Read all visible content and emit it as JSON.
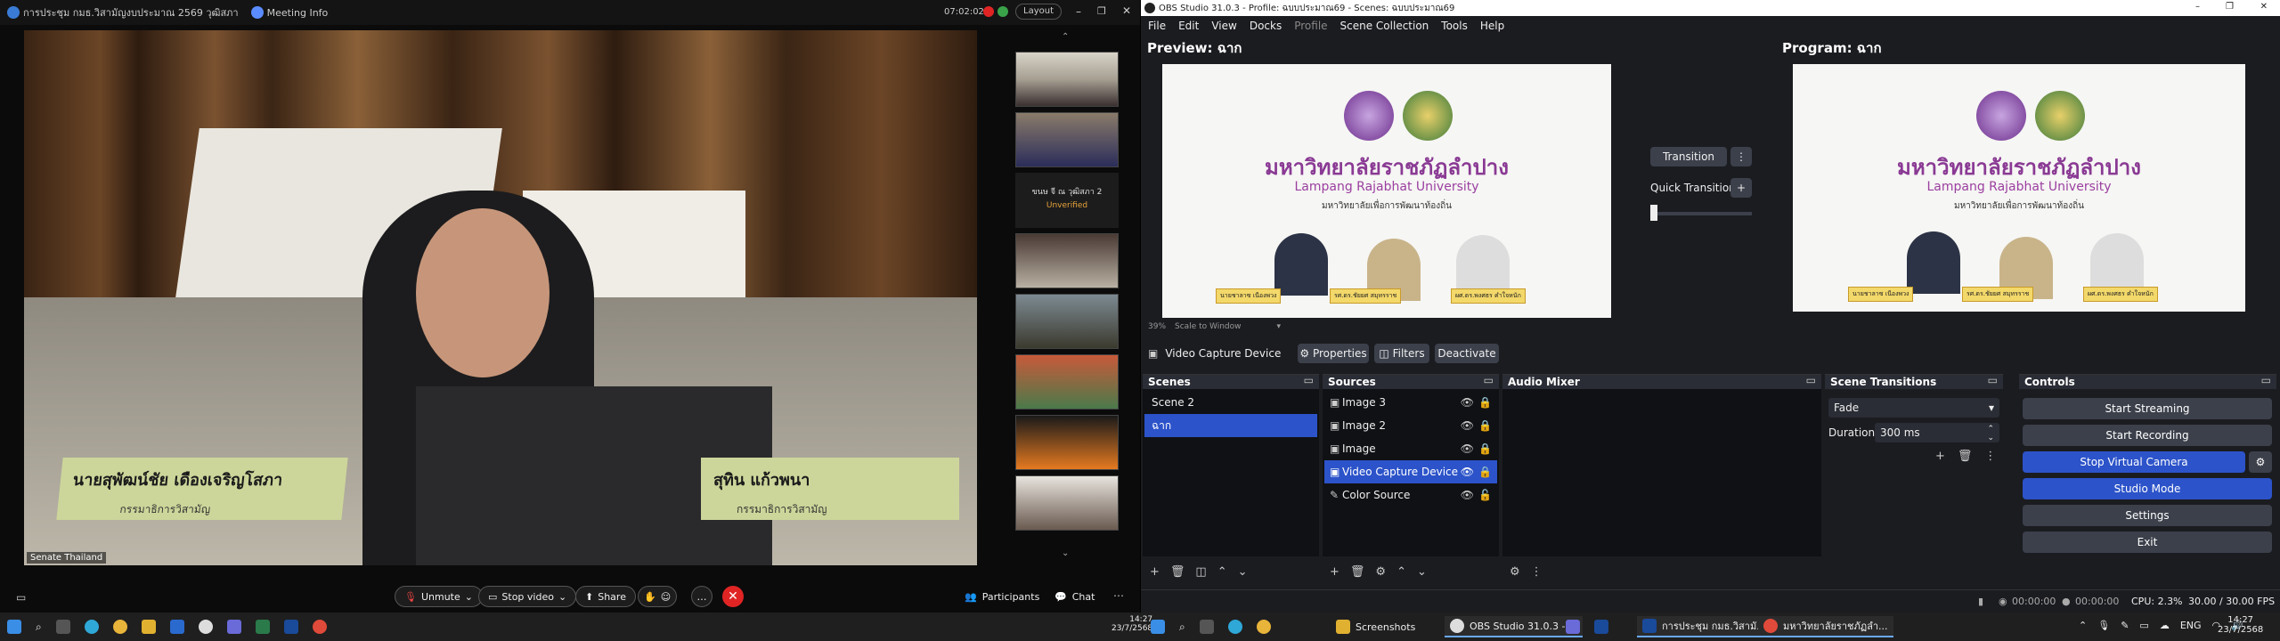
{
  "meeting": {
    "title": "การประชุม กมธ.วิสามัญงบประมาณ 2569 วุฒิสภา",
    "meeting_info": "Meeting Info",
    "timer": "07:02:02",
    "layout": "Layout",
    "video_label": "Senate Thailand",
    "nameplate_left": "นายสุพัฒน์ชัย เดืองเจริญโสภา",
    "nameplate_left_sub": "กรรมาธิการวิสามัญ",
    "nameplate_right": "สุทิน แก้วพนา",
    "nameplate_right_sub": "กรรมาธิการวิสามัญ",
    "thumb_text_participant": "ขนษ จี ณ วุฒิสภา 2",
    "thumb_text_status": "Unverified",
    "controls": {
      "unmute": "Unmute",
      "stop_video": "Stop video",
      "share": "Share",
      "participants": "Participants",
      "chat": "Chat"
    }
  },
  "obs": {
    "title": "OBS Studio 31.0.3 - Profile: ฉบบประมาณ69 - Scenes: ฉบบประมาณ69",
    "menu": [
      "File",
      "Edit",
      "View",
      "Docks",
      "Profile",
      "Scene Collection",
      "Tools",
      "Help"
    ],
    "preview_title": "Preview: ฉาก",
    "program_title": "Program: ฉาก",
    "screen": {
      "thai_name": "มหาวิทยาลัยราชภัฏลำปาง",
      "eng_name": "Lampang Rajabhat University",
      "sub_name": "มหาวิทยาลัยเพื่อการพัฒนาท้องถิ่น",
      "nameplates": [
        "นายชาลาซ เนืองพวง",
        "รศ.ดร.ชัยยศ สมุทรราช",
        "ผศ.ดร.พงศธร คำใจหนัก"
      ]
    },
    "zoom": "39%",
    "scale_mode": "Scale to Window",
    "transition_btn": "Transition",
    "quick_transitions": "Quick Transitions",
    "source_toolbar": {
      "name": "Video Capture Device",
      "properties": "Properties",
      "filters": "Filters",
      "deactivate": "Deactivate"
    },
    "scenes": {
      "title": "Scenes",
      "items": [
        "Scene 2",
        "ฉาก"
      ]
    },
    "sources": {
      "title": "Sources",
      "items": [
        "Image 3",
        "Image 2",
        "Image",
        "Video Capture Device",
        "Color Source"
      ]
    },
    "audio_mixer": "Audio Mixer",
    "scene_transitions": {
      "title": "Scene Transitions",
      "type": "Fade",
      "duration_label": "Duration",
      "duration_value": "300 ms"
    },
    "controls": {
      "title": "Controls",
      "start_streaming": "Start Streaming",
      "start_recording": "Start Recording",
      "stop_virtual_camera": "Stop Virtual Camera",
      "studio_mode": "Studio Mode",
      "settings": "Settings",
      "exit": "Exit"
    },
    "status": {
      "stream_time": "00:00:00",
      "rec_time": "00:00:00",
      "cpu": "CPU: 2.3%",
      "fps": "30.00 / 30.00 FPS"
    }
  },
  "taskbar": {
    "left_time": "14:27",
    "left_date": "23/7/2568",
    "apps": [
      "Screenshots",
      "OBS Studio 31.0.3 - ...",
      "การประชุม กมธ.วิสามั...",
      "มหาวิทยาลัยราชภัฏลำ..."
    ],
    "lang": "ENG",
    "time": "14:27",
    "date": "23/7/2568"
  }
}
